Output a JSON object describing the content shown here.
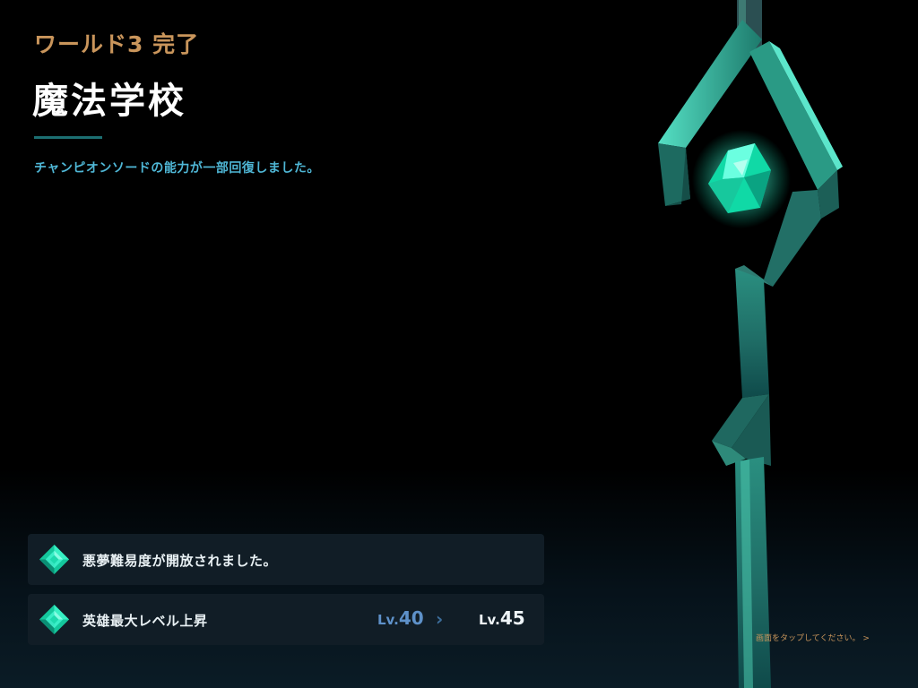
{
  "header": {
    "world_status": "ワールド3 完了",
    "world_title": "魔法学校",
    "message": "チャンピオンソードの能力が一部回復しました。"
  },
  "rewards": [
    {
      "label": "悪夢難易度が開放されました。",
      "icon": "gem-icon"
    },
    {
      "label": "英雄最大レベル上昇",
      "icon": "gem-icon",
      "level_from_prefix": "Lv.",
      "level_from": "40",
      "arrow": "›",
      "level_to_prefix": "Lv.",
      "level_to": "45"
    }
  ],
  "footer": {
    "tap_prompt": "画面をタップしてください。 >"
  },
  "colors": {
    "accent_gold": "#c9955b",
    "accent_cyan": "#4fb7d6",
    "card_bg": "#111d26",
    "gem": "#1fe0b0",
    "sword_teal": "#1e8f7c"
  },
  "decor": {
    "sword_icon": "champion-sword-icon"
  }
}
